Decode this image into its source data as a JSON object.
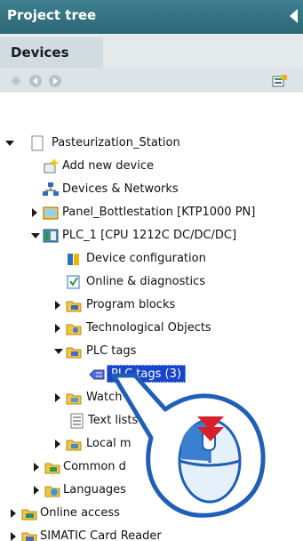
{
  "header": {
    "title": "Project tree"
  },
  "tabs": [
    {
      "label": "Devices"
    }
  ],
  "tree": [
    {
      "label": "Pasteurization_Station",
      "icon": "document-icon",
      "expander": "expanded"
    },
    {
      "label": "Add new device",
      "icon": "add-device-icon",
      "expander": "none"
    },
    {
      "label": "Devices & Networks",
      "icon": "network-icon",
      "expander": "none"
    },
    {
      "label": "Panel_Bottlestation [KTP1000 PN]",
      "icon": "hmi-panel-icon",
      "expander": "collapsed"
    },
    {
      "label": "PLC_1 [CPU 1212C DC/DC/DC]",
      "icon": "plc-icon",
      "expander": "expanded"
    },
    {
      "label": "Device configuration",
      "icon": "device-config-icon",
      "expander": "none"
    },
    {
      "label": "Online & diagnostics",
      "icon": "online-diagnostics-icon",
      "expander": "none"
    },
    {
      "label": "Program blocks",
      "icon": "folder-icon",
      "expander": "collapsed"
    },
    {
      "label": "Technological Objects",
      "icon": "folder-icon",
      "expander": "collapsed"
    },
    {
      "label": "PLC tags",
      "icon": "folder-open-icon",
      "expander": "expanded"
    },
    {
      "label": "PLC tags (3)",
      "icon": "tag-table-icon",
      "expander": "none",
      "selected": true
    },
    {
      "label": "Watch t",
      "icon": "folder-icon",
      "expander": "collapsed"
    },
    {
      "label": "Text lists",
      "icon": "text-list-icon",
      "expander": "none"
    },
    {
      "label": "Local m",
      "icon": "folder-icon",
      "expander": "collapsed"
    },
    {
      "label": "Common d",
      "icon": "folder-icon",
      "expander": "collapsed"
    },
    {
      "label": "Languages",
      "icon": "languages-icon",
      "expander": "collapsed"
    },
    {
      "label": "Online access",
      "icon": "online-access-icon",
      "expander": "collapsed"
    },
    {
      "label": "SIMATIC Card Reader",
      "icon": "card-reader-icon",
      "expander": "collapsed"
    }
  ],
  "colors": {
    "header": "#2c6676",
    "selection": "#1746c8",
    "callout": "#1f5fb8",
    "arrow": "#d8202a"
  }
}
